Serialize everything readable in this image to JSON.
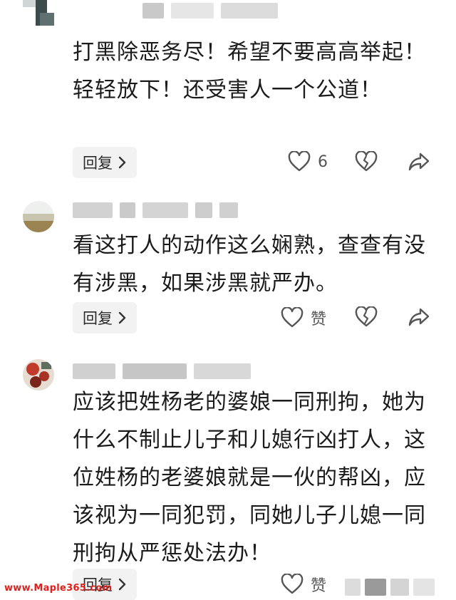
{
  "comments": [
    {
      "text": "打黑除恶务尽！希望不要高高举起！轻轻放下！还受害人一个公道！",
      "reply_label": "回复",
      "like_text": "6"
    },
    {
      "text": "看这打人的动作这么娴熟，查查有没有涉黑，如果涉黑就严办。",
      "reply_label": "回复",
      "like_text": "赞"
    },
    {
      "text": "应该把姓杨老的婆娘一同刑拘，她为什么不制止儿子和儿媳行凶打人，这位姓杨的老婆娘就是一伙的帮凶，应该视为一同犯罚，同她儿子儿媳一同刑拘从严惩处法办！",
      "reply_label": "回复",
      "like_text": "赞"
    }
  ],
  "watermark": "www.Maple365.com",
  "colors": {
    "icon": "#555555",
    "reply_bg": "#f2f2f2",
    "watermark": "#e0201c"
  },
  "icons": [
    "heart-outline-icon",
    "broken-heart-icon",
    "share-arrow-icon",
    "chevron-right-icon"
  ]
}
